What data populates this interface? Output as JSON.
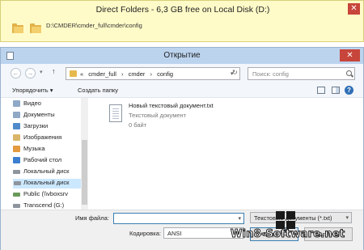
{
  "direct_folders": {
    "title": "Direct Folders  -  6,3 GB free on Local Disk (D:)",
    "path": "D:\\CMDER\\cmder_full\\cmder\\config",
    "close_glyph": "✕"
  },
  "dialog": {
    "title": "Открытие",
    "close_glyph": "✕",
    "nav": {
      "back": "←",
      "forward": "→",
      "up": "↑",
      "dropdown": "▾",
      "refresh": "↻"
    },
    "breadcrumb_prefix": "«",
    "breadcrumbs": [
      "cmder_full",
      "›",
      "cmder",
      "›",
      "config"
    ],
    "search_placeholder": "Поиск: config",
    "toolbar": {
      "organize": "Упорядочить ▾",
      "new_folder": "Создать папку",
      "help": "?"
    },
    "sidebar": [
      {
        "label": "Видео",
        "icon": "video-icon"
      },
      {
        "label": "Документы",
        "icon": "documents-icon"
      },
      {
        "label": "Загрузки",
        "icon": "downloads-icon"
      },
      {
        "label": "Изображения",
        "icon": "pictures-icon"
      },
      {
        "label": "Музыка",
        "icon": "music-icon"
      },
      {
        "label": "Рабочий стол",
        "icon": "desktop-icon"
      },
      {
        "label": "Локальный диск",
        "icon": "drive-icon"
      },
      {
        "label": "Локальный диск",
        "icon": "drive-icon",
        "selected": true
      },
      {
        "label": "Public (\\\\vboxsrv",
        "icon": "network-drive-icon"
      },
      {
        "label": "Transcend (G:)",
        "icon": "usb-drive-icon"
      }
    ],
    "file": {
      "name": "Новый текстовый документ.txt",
      "type": "Текстовый документ",
      "size": "0 байт"
    },
    "bottom": {
      "filename_label": "Имя файла:",
      "filename_value": "",
      "filter_value": "Текстовые документы (*.txt)",
      "encoding_label": "Кодировка:",
      "encoding_value": "ANSI",
      "open_button": "Открыть",
      "cancel_button": "Отмена"
    }
  },
  "watermark": {
    "text": "Win8-Software.net"
  },
  "colors": {
    "direct_folders_bg": "#fffbc8",
    "close_red": "#c7453a",
    "titlebar": "#bcd3ee",
    "selection": "#cce8ff"
  }
}
